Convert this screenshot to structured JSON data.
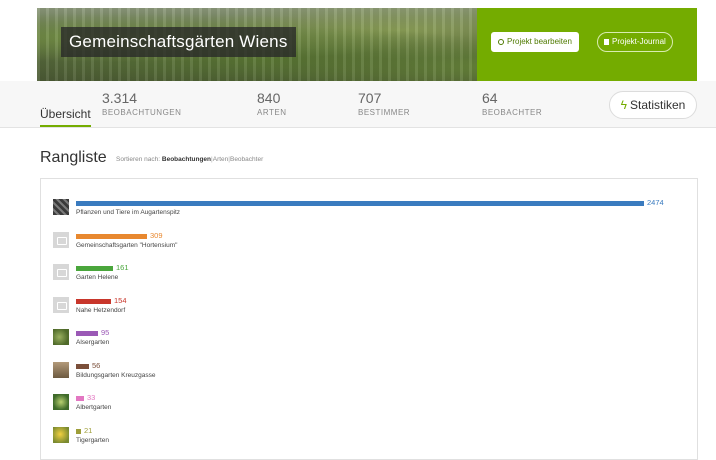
{
  "project": {
    "title": "Gemeinschaftsgärten Wiens",
    "edit_label": "Projekt bearbeiten",
    "journal_label": "Projekt-Journal"
  },
  "stats": {
    "overview_tab": "Übersicht",
    "observations": {
      "value": "3.314",
      "label": "BEOBACHTUNGEN"
    },
    "species": {
      "value": "840",
      "label": "ARTEN"
    },
    "identifiers": {
      "value": "707",
      "label": "BESTIMMER"
    },
    "observers": {
      "value": "64",
      "label": "BEOBACHTER"
    },
    "stats_button": "Statistiken"
  },
  "leaderboard": {
    "title": "Rangliste",
    "sort_prefix": "Sortieren nach:",
    "sort_options": [
      "Beobachtungen",
      "Arten",
      "Beobachter"
    ],
    "max_value": 2474,
    "rows": [
      {
        "name": "Pflanzen und Tiere im Augartenspitz",
        "value": 2474,
        "color": "#3a7bbf",
        "thumb": "photo-dark"
      },
      {
        "name": "Gemeinschaftsgarten \"Hortensium\"",
        "value": 309,
        "color": "#e8882f",
        "thumb": "placeholder"
      },
      {
        "name": "Garten Helene",
        "value": 161,
        "color": "#4aa63c",
        "thumb": "placeholder"
      },
      {
        "name": "Nahe Hetzendorf",
        "value": 154,
        "color": "#c8362b",
        "thumb": "placeholder"
      },
      {
        "name": "Alsergarten",
        "value": 95,
        "color": "#9b59b6",
        "thumb": "photo-green"
      },
      {
        "name": "Bildungsgarten Kreuzgasse",
        "value": 56,
        "color": "#7b4f3a",
        "thumb": "photo-brown"
      },
      {
        "name": "Albertgarten",
        "value": 33,
        "color": "#e377c2",
        "thumb": "photo-green2"
      },
      {
        "name": "Tigergarten",
        "value": 21,
        "color": "#9e9e3a",
        "thumb": "photo-yellow"
      }
    ]
  }
}
